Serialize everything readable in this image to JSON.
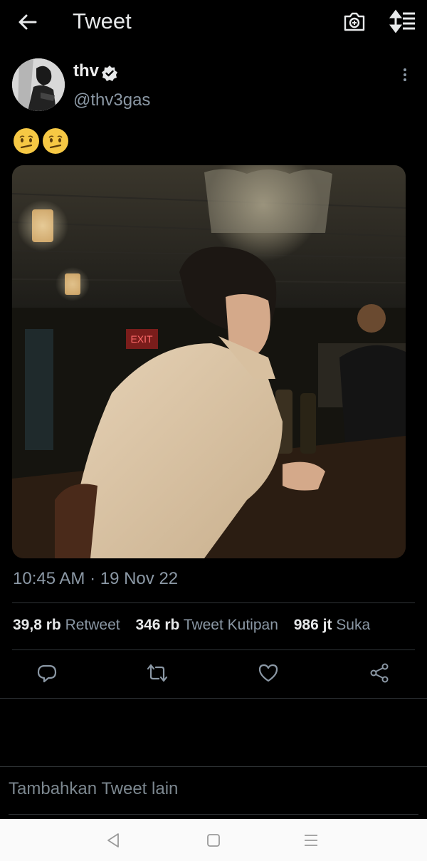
{
  "header": {
    "title": "Tweet",
    "icons": [
      "back-arrow-icon",
      "camera-icon",
      "sort-icon"
    ]
  },
  "author": {
    "name": "thv",
    "handle": "@thv3gas",
    "verified": true
  },
  "tweet": {
    "text": "🫤🫤",
    "media_alt": "photo"
  },
  "timestamp": "10:45 AM · 19 Nov 22",
  "stats": [
    {
      "count": "39,8 rb",
      "label": "Retweet"
    },
    {
      "count": "346 rb",
      "label": "Tweet Kutipan"
    },
    {
      "count": "986 jt",
      "label": "Suka"
    }
  ],
  "actions": [
    "reply-icon",
    "retweet-icon",
    "like-icon",
    "share-icon"
  ],
  "composer": {
    "placeholder": "Tambahkan Tweet lain"
  },
  "system_nav": [
    "back-triangle-icon",
    "home-square-icon",
    "recents-menu-icon"
  ],
  "colors": {
    "background": "#000000",
    "secondary_text": "#8b98a5",
    "divider": "#2f3336"
  }
}
